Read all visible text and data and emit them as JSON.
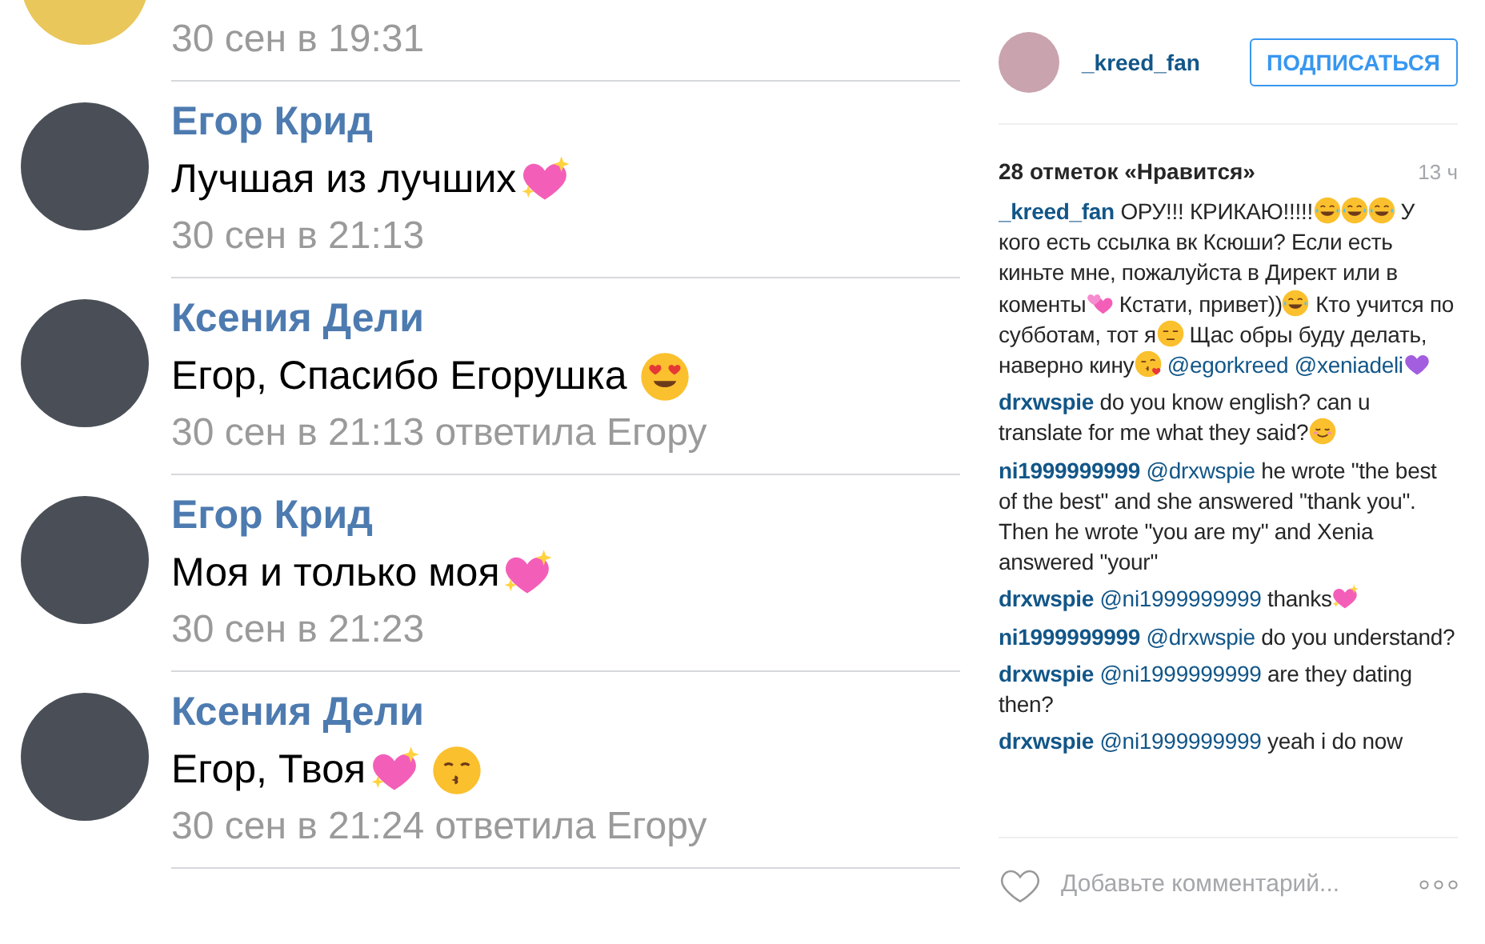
{
  "post_image": {
    "comments": [
      {
        "date": "30 сен в 19:31"
      },
      {
        "author": "Егор Крид",
        "message": [
          {
            "kind": "text",
            "text": "Лучшая из лучших"
          },
          {
            "kind": "sparkle-heart"
          }
        ],
        "date": "30 сен в 21:13"
      },
      {
        "author": "Ксения Дели",
        "message": [
          {
            "kind": "text",
            "text": "Егор, Спасибо Егорушка"
          },
          {
            "kind": "heart-eyes"
          }
        ],
        "date": "30 сен в 21:13 ответила Егору"
      },
      {
        "author": "Егор Крид",
        "message": [
          {
            "kind": "text",
            "text": "Моя и только моя"
          },
          {
            "kind": "sparkle-heart"
          }
        ],
        "date": "30 сен в 21:23"
      },
      {
        "author": "Ксения Дели",
        "message": [
          {
            "kind": "text",
            "text": "Егор, Твоя"
          },
          {
            "kind": "sparkle-heart"
          },
          {
            "kind": "kiss"
          }
        ],
        "date": "30 сен в 21:24 ответила Егору"
      }
    ]
  },
  "header": {
    "username": "_kreed_fan",
    "follow_button": "ПОДПИСАТЬСЯ"
  },
  "likes": "28 отметок «Нравится»",
  "age": "13 ч",
  "comments": [
    {
      "user": "_kreed_fan",
      "parts": [
        {
          "kind": "text",
          "text": "ОРУ!!! КРИКАЮ!!!!!"
        },
        {
          "kind": "tears-of-joy"
        },
        {
          "kind": "tears-of-joy"
        },
        {
          "kind": "tears-of-joy"
        },
        {
          "kind": "text",
          "text": "У кого есть ссылка вк Ксюши? Если есть киньте мне, пожалуйста в Директ или в коменты"
        },
        {
          "kind": "two-hearts"
        },
        {
          "kind": "text",
          "text": "Кстати, привет))"
        },
        {
          "kind": "tears-of-joy"
        },
        {
          "kind": "text",
          "text": "Кто учится по субботам, тот я"
        },
        {
          "kind": "unamused"
        },
        {
          "kind": "text",
          "text": "Щас обры буду делать, наверно кину"
        },
        {
          "kind": "blow-kiss"
        },
        {
          "kind": "mention",
          "text": "@egorkreed"
        },
        {
          "kind": "mention",
          "text": "@xeniadeli"
        },
        {
          "kind": "purple-heart"
        }
      ]
    },
    {
      "user": "drxwspie",
      "parts": [
        {
          "kind": "text",
          "text": "do you know english? can u translate for me what they said?"
        },
        {
          "kind": "relieved"
        }
      ]
    },
    {
      "user": "ni1999999999",
      "parts": [
        {
          "kind": "mention",
          "text": "@drxwspie"
        },
        {
          "kind": "text",
          "text": "he wrote \"the best of the best\" and she answered \"thank you\". Then he wrote \"you are my\" and Xenia answered \"your\""
        }
      ]
    },
    {
      "user": "drxwspie",
      "parts": [
        {
          "kind": "mention",
          "text": "@ni1999999999"
        },
        {
          "kind": "text",
          "text": "thanks"
        },
        {
          "kind": "sparkle-heart"
        }
      ]
    },
    {
      "user": "ni1999999999",
      "parts": [
        {
          "kind": "mention",
          "text": "@drxwspie"
        },
        {
          "kind": "text",
          "text": "do you understand?"
        }
      ]
    },
    {
      "user": "drxwspie",
      "parts": [
        {
          "kind": "mention",
          "text": "@ni1999999999"
        },
        {
          "kind": "text",
          "text": "are they dating then?"
        }
      ]
    },
    {
      "user": "drxwspie",
      "parts": [
        {
          "kind": "mention",
          "text": "@ni1999999999"
        },
        {
          "kind": "text",
          "text": "yeah i do now"
        }
      ]
    }
  ],
  "comment_field": {
    "placeholder": "Добавьте комментарий..."
  }
}
